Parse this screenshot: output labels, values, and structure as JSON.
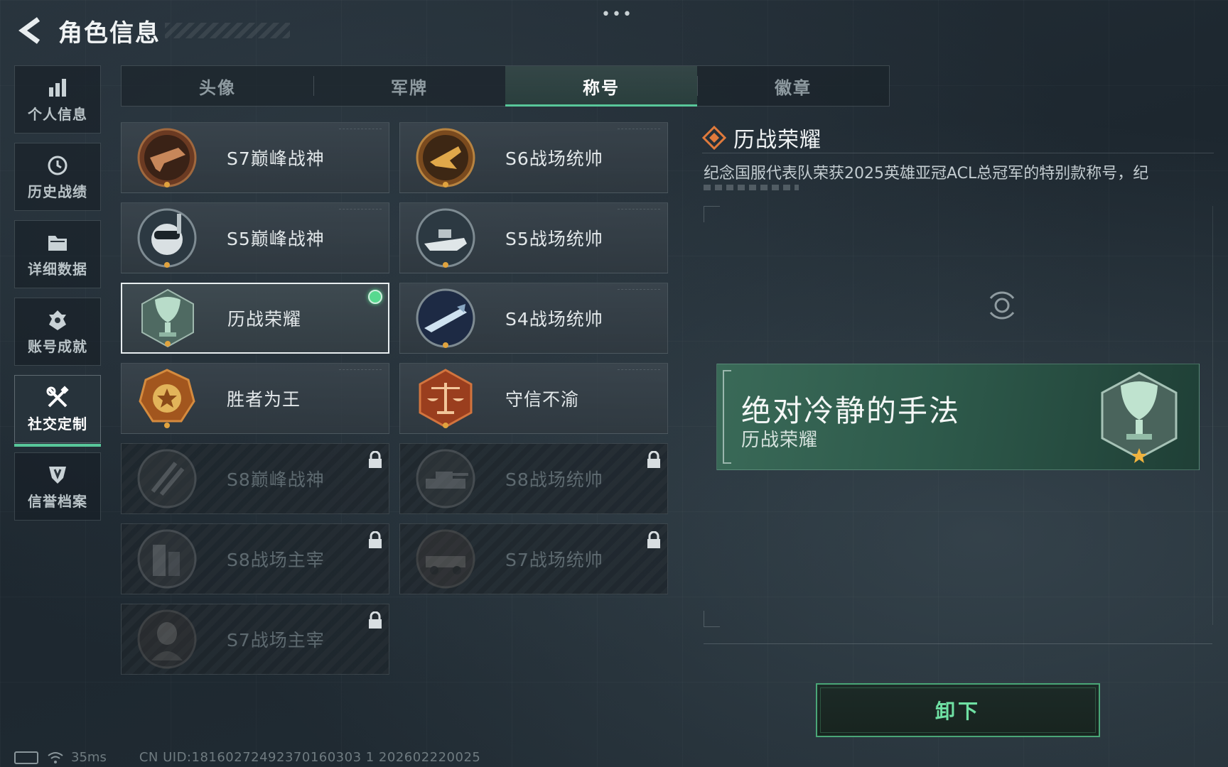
{
  "header": {
    "title": "角色信息",
    "more": "•••"
  },
  "sidebar": {
    "items": [
      {
        "label": "个人信息",
        "icon": "bar-chart-icon"
      },
      {
        "label": "历史战绩",
        "icon": "history-icon"
      },
      {
        "label": "详细数据",
        "icon": "folder-icon"
      },
      {
        "label": "账号成就",
        "icon": "achievement-icon"
      },
      {
        "label": "社交定制",
        "icon": "tools-icon",
        "active": true
      },
      {
        "label": "信誉档案",
        "icon": "shield-icon"
      }
    ]
  },
  "tabs": [
    {
      "label": "头像"
    },
    {
      "label": "军牌"
    },
    {
      "label": "称号",
      "active": true
    },
    {
      "label": "徽章"
    }
  ],
  "titles": [
    {
      "name": "S7巅峰战神",
      "locked": false
    },
    {
      "name": "S6战场统帅",
      "locked": false
    },
    {
      "name": "S5巅峰战神",
      "locked": false
    },
    {
      "name": "S5战场统帅",
      "locked": false
    },
    {
      "name": "历战荣耀",
      "locked": false,
      "selected": true,
      "equipped": true
    },
    {
      "name": "S4战场统帅",
      "locked": false
    },
    {
      "name": "胜者为王",
      "locked": false
    },
    {
      "name": "守信不渝",
      "locked": false
    },
    {
      "name": "S8巅峰战神",
      "locked": true
    },
    {
      "name": "S8战场统帅",
      "locked": true
    },
    {
      "name": "S8战场主宰",
      "locked": true
    },
    {
      "name": "S7战场统帅",
      "locked": true
    },
    {
      "name": "S7战场主宰",
      "locked": true
    }
  ],
  "detail": {
    "title": "历战荣耀",
    "description": "纪念国服代表队荣获2025英雄亚冠ACL总冠军的特别款称号，纪",
    "nameplate": {
      "main": "绝对冷静的手法",
      "sub": "历战荣耀"
    },
    "action_label": "卸下"
  },
  "status_bar": {
    "ping": "35ms",
    "uid": "CN UID:18160272492370160303 1 202602220025"
  },
  "colors": {
    "accent_green": "#58c79a",
    "equipped_dot": "#57d98f",
    "diamond_orange": "#e07a3c",
    "nameplate_green": "#3a6a58"
  }
}
